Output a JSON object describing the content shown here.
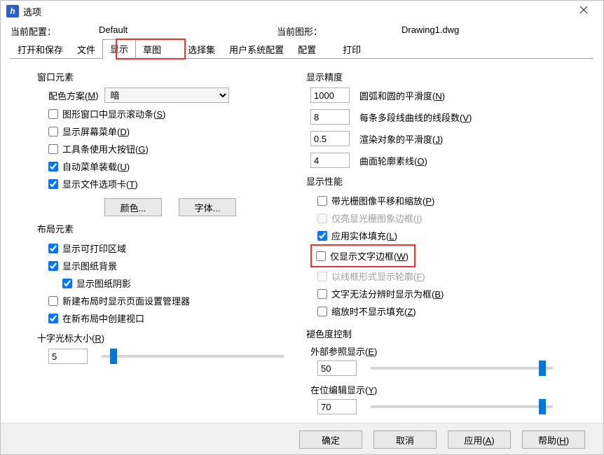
{
  "window": {
    "title": "选项"
  },
  "header": {
    "config_label": "当前配置：",
    "config_value": "Default",
    "drawing_label": "当前图形：",
    "drawing_value": "Drawing1.dwg"
  },
  "tabs": [
    "打开和保存",
    "文件",
    "显示",
    "草图",
    "选择集",
    "用户系统配置",
    "配置",
    "打印"
  ],
  "tabs_active": 2,
  "left": {
    "window_elements_label": "窗口元素",
    "color_scheme_label": "配色方案(M)",
    "color_scheme_value": "暗",
    "cb_scrollbar": "图形窗口中显示滚动条(S)",
    "cb_screen_menu": "显示屏幕菜单(D)",
    "cb_large_buttons": "工具条使用大按钮(G)",
    "cb_auto_menu": "自动菜单装载(U)",
    "cb_file_tabs": "显示文件选项卡(T)",
    "btn_colors": "颜色...",
    "btn_fonts": "字体...",
    "layout_label": "布局元素",
    "cb_layout_print": "显示可打印区域",
    "cb_layout_bg": "显示图纸背景",
    "cb_layout_shadow": "显示图纸阴影",
    "cb_layout_mgr": "新建布局时显示页面设置管理器",
    "cb_layout_vp": "在新布局中创建视口",
    "crosshair_label": "十字光标大小(R)",
    "crosshair_value": "5"
  },
  "right": {
    "precision_label": "显示精度",
    "p_arc_v": "1000",
    "p_arc_l": "圆弧和圆的平滑度(N)",
    "p_seg_v": "8",
    "p_seg_l": "每条多段线曲线的线段数(V)",
    "p_rend_v": "0.5",
    "p_rend_l": "渲染对象的平滑度(J)",
    "p_surf_v": "4",
    "p_surf_l": "曲面轮廓素线(O)",
    "perf_label": "显示性能",
    "cb_pan_raster": "带光栅图像平移和缩放(P)",
    "cb_raster_frame": "仅亮显光栅图象边框(I)",
    "cb_solid_fill": "应用实体填充(L)",
    "cb_text_frame": "仅显示文字边框(W)",
    "cb_wire_frame": "以线框形式显示轮廓(F)",
    "cb_text_box": "文字无法分辨时显示为框(B)",
    "cb_zoom_fill": "缩放时不显示填充(Z)",
    "fade_label": "褪色度控制",
    "xref_label": "外部参照显示(E)",
    "xref_value": "50",
    "inplace_label": "在位编辑显示(Y)",
    "inplace_value": "70"
  },
  "footer": {
    "ok": "确定",
    "cancel": "取消",
    "apply": "应用(A)",
    "help": "帮助(H)"
  }
}
